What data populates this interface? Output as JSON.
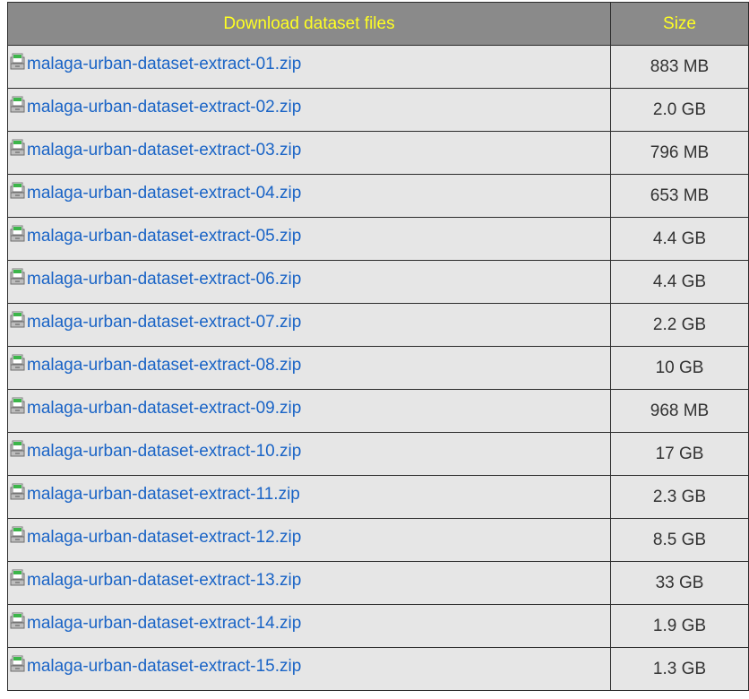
{
  "table": {
    "header_name": "Download dataset files",
    "header_size": "Size",
    "colors": {
      "header_bg": "#8a8a8a",
      "header_text": "#ffff22",
      "row_bg": "#e6e6e6",
      "link": "#1a64c6"
    },
    "rows": [
      {
        "name": "malaga-urban-dataset-extract-01.zip",
        "size": "883 MB",
        "icon": "zip-file-icon"
      },
      {
        "name": "malaga-urban-dataset-extract-02.zip",
        "size": "2.0 GB",
        "icon": "zip-file-icon"
      },
      {
        "name": "malaga-urban-dataset-extract-03.zip",
        "size": "796 MB",
        "icon": "zip-file-icon"
      },
      {
        "name": "malaga-urban-dataset-extract-04.zip",
        "size": "653 MB",
        "icon": "zip-file-icon"
      },
      {
        "name": "malaga-urban-dataset-extract-05.zip",
        "size": "4.4 GB",
        "icon": "zip-file-icon"
      },
      {
        "name": "malaga-urban-dataset-extract-06.zip",
        "size": "4.4 GB",
        "icon": "zip-file-icon"
      },
      {
        "name": "malaga-urban-dataset-extract-07.zip",
        "size": "2.2 GB",
        "icon": "zip-file-icon"
      },
      {
        "name": "malaga-urban-dataset-extract-08.zip",
        "size": "10 GB",
        "icon": "zip-file-icon"
      },
      {
        "name": "malaga-urban-dataset-extract-09.zip",
        "size": "968 MB",
        "icon": "zip-file-icon"
      },
      {
        "name": "malaga-urban-dataset-extract-10.zip",
        "size": "17 GB",
        "icon": "zip-file-icon"
      },
      {
        "name": "malaga-urban-dataset-extract-11.zip",
        "size": "2.3 GB",
        "icon": "zip-file-icon"
      },
      {
        "name": "malaga-urban-dataset-extract-12.zip",
        "size": "8.5 GB",
        "icon": "zip-file-icon"
      },
      {
        "name": "malaga-urban-dataset-extract-13.zip",
        "size": "33 GB",
        "icon": "zip-file-icon"
      },
      {
        "name": "malaga-urban-dataset-extract-14.zip",
        "size": "1.9 GB",
        "icon": "zip-file-icon"
      },
      {
        "name": "malaga-urban-dataset-extract-15.zip",
        "size": "1.3 GB",
        "icon": "zip-file-icon"
      }
    ]
  }
}
